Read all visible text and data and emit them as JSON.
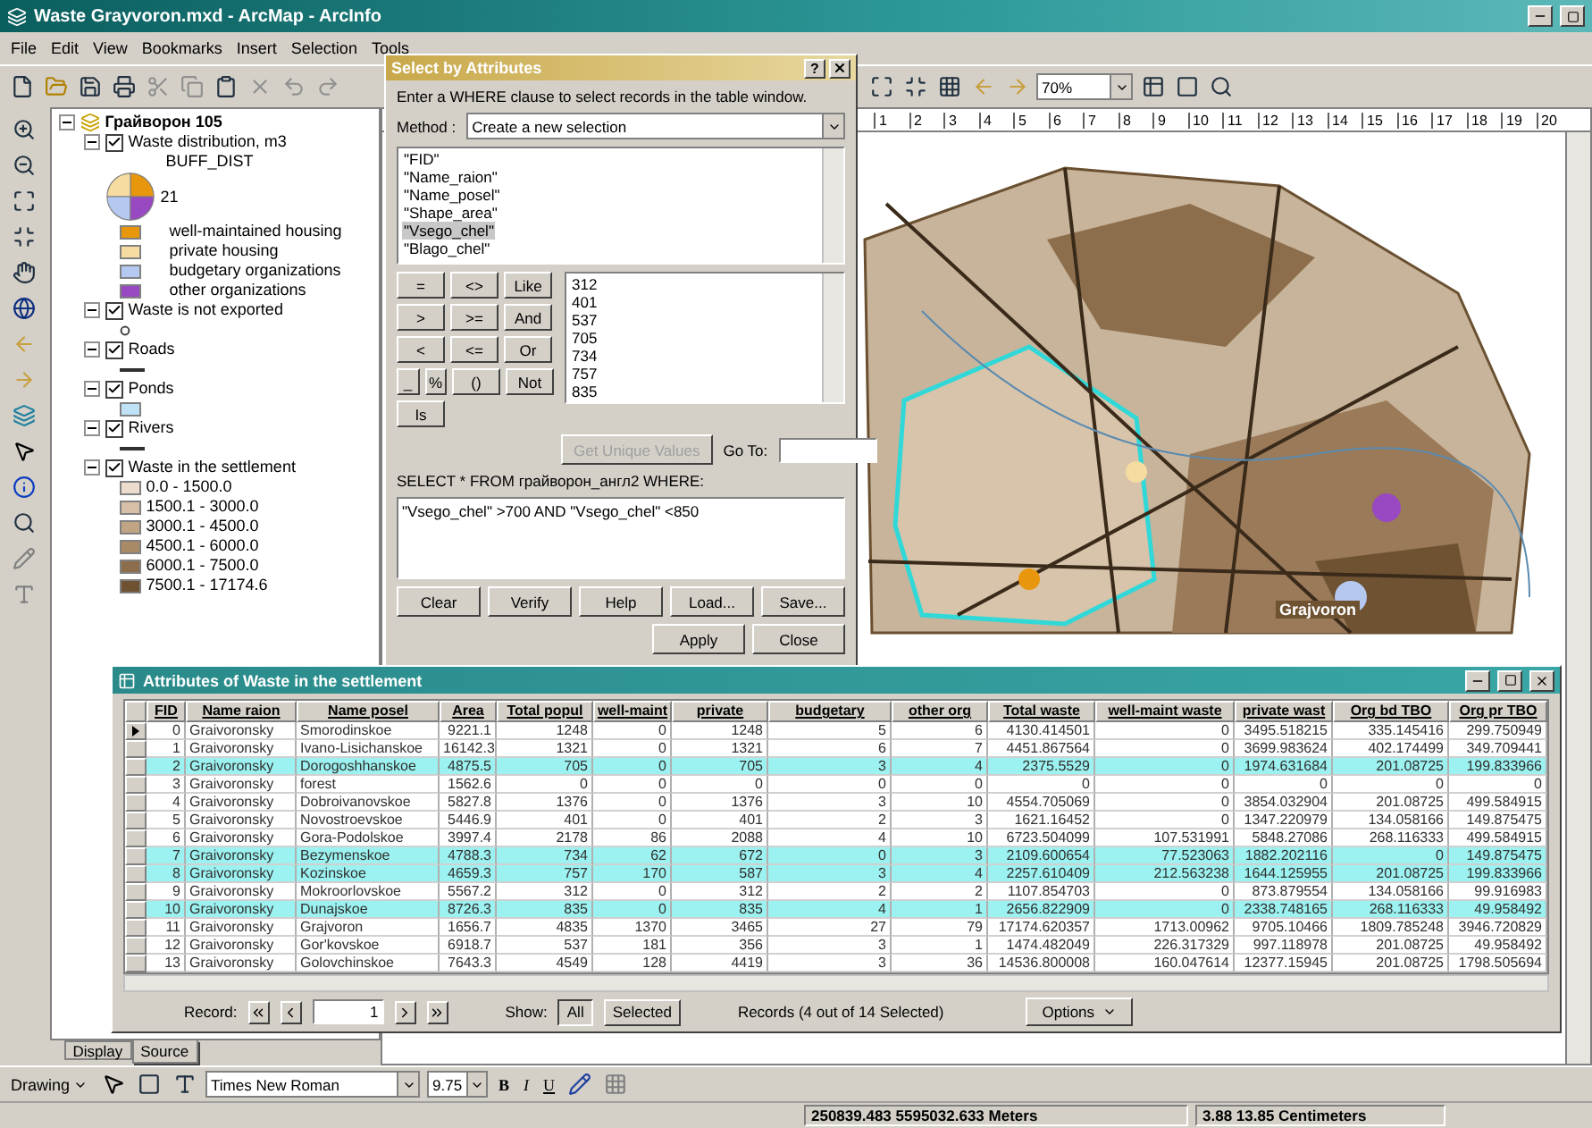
{
  "window": {
    "title": "Waste Grayvoron.mxd - ArcMap - ArcInfo"
  },
  "menu": [
    "File",
    "Edit",
    "View",
    "Bookmarks",
    "Insert",
    "Selection",
    "Tools"
  ],
  "map_scale": "70%",
  "ruler": [
    "1",
    "2",
    "3",
    "4",
    "5",
    "6",
    "7",
    "8",
    "9",
    "10",
    "11",
    "12",
    "13",
    "14",
    "15",
    "16",
    "17",
    "18",
    "19",
    "20"
  ],
  "toc": {
    "root": "Грайворон 105",
    "layers": [
      {
        "name": "Waste distribution, m3",
        "checked": true,
        "kind": "pie",
        "field": "BUFF_DIST",
        "size_label": "21",
        "classes": [
          {
            "label": "well-maintained housing",
            "color": "#e8960c"
          },
          {
            "label": "private housing",
            "color": "#f6dca0"
          },
          {
            "label": "budgetary organizations",
            "color": "#b4c8f0"
          },
          {
            "label": "other organizations",
            "color": "#9848c0"
          }
        ]
      },
      {
        "name": "Waste is not exported",
        "checked": true,
        "kind": "point"
      },
      {
        "name": "Roads",
        "checked": true,
        "kind": "line"
      },
      {
        "name": "Ponds",
        "checked": true,
        "kind": "fill",
        "color": "#bfe2f6"
      },
      {
        "name": "Rivers",
        "checked": true,
        "kind": "line"
      },
      {
        "name": "Waste in the settlement",
        "checked": true,
        "kind": "classes",
        "classes": [
          {
            "label": "0.0 - 1500.0",
            "color": "#ecdccc"
          },
          {
            "label": "1500.1 - 3000.0",
            "color": "#d6bfa6"
          },
          {
            "label": "3000.1 - 4500.0",
            "color": "#c0a584"
          },
          {
            "label": "4500.1 - 6000.0",
            "color": "#a88a66"
          },
          {
            "label": "6000.1 - 7500.0",
            "color": "#8c6e4c"
          },
          {
            "label": "7500.1 - 17174.6",
            "color": "#6e5232"
          }
        ]
      }
    ],
    "tabs": [
      {
        "label": "Display",
        "selected": false
      },
      {
        "label": "Source",
        "selected": true
      }
    ]
  },
  "map_labels": [
    "Grajvoron"
  ],
  "dialog": {
    "title": "Select by Attributes",
    "help": "?",
    "instruction": "Enter a WHERE clause to select records in the table window.",
    "method_label": "Method :",
    "method": "Create a new selection",
    "fields": [
      {
        "label": "\"FID\"",
        "selected": false
      },
      {
        "label": "\"Name_raion\"",
        "selected": false
      },
      {
        "label": "\"Name_posel\"",
        "selected": false
      },
      {
        "label": "\"Shape_area\"",
        "selected": false
      },
      {
        "label": "\"Vsego_chel\"",
        "selected": true
      },
      {
        "label": "\"Blago_chel\"",
        "selected": false
      }
    ],
    "operators": [
      [
        "=",
        "<>",
        "Like"
      ],
      [
        ">",
        ">=",
        "And"
      ],
      [
        "<",
        "<=",
        "Or"
      ],
      [
        "_",
        "%",
        "()",
        "Not"
      ],
      [
        "Is"
      ]
    ],
    "values": [
      "312",
      "401",
      "537",
      "705",
      "734",
      "757",
      "835"
    ],
    "unique_button": {
      "label": "Get Unique Values",
      "disabled": true
    },
    "goto_label": "Go To:",
    "query_label": "SELECT * FROM грайворон_англ2 WHERE:",
    "expression": "\"Vsego_chel\" >700 AND \"Vsego_chel\" <850",
    "buttons": [
      "Clear",
      "Verify",
      "Help",
      "Load...",
      "Save..."
    ],
    "footer_buttons": [
      "Apply",
      "Close"
    ]
  },
  "table": {
    "title": "Attributes of Waste in the settlement",
    "columns": [
      "FID",
      "Name raion",
      "Name posel",
      "Area",
      "Total popul",
      "well-maint",
      "private",
      "budgetary",
      "other org",
      "Total waste",
      "well-maint waste",
      "private wast",
      "Org bd TBO",
      "Org pr TBO"
    ],
    "rows": [
      {
        "selected": false,
        "cells": [
          "0",
          "Graivoronsky",
          "Smorodinskoe",
          "9221.1",
          "1248",
          "0",
          "1248",
          "5",
          "6",
          "4130.414501",
          "0",
          "3495.518215",
          "335.145416",
          "299.750949"
        ]
      },
      {
        "selected": false,
        "cells": [
          "1",
          "Graivoronsky",
          "Ivano-Lisichanskoe",
          "16142.3",
          "1321",
          "0",
          "1321",
          "6",
          "7",
          "4451.867564",
          "0",
          "3699.983624",
          "402.174499",
          "349.709441"
        ]
      },
      {
        "selected": true,
        "cells": [
          "2",
          "Graivoronsky",
          "Dorogoshhanskoe",
          "4875.5",
          "705",
          "0",
          "705",
          "3",
          "4",
          "2375.5529",
          "0",
          "1974.631684",
          "201.08725",
          "199.833966"
        ]
      },
      {
        "selected": false,
        "cells": [
          "3",
          "Graivoronsky",
          "forest",
          "1562.6",
          "0",
          "0",
          "0",
          "0",
          "0",
          "0",
          "0",
          "0",
          "0",
          "0"
        ]
      },
      {
        "selected": false,
        "cells": [
          "4",
          "Graivoronsky",
          "Dobroivanovskoe",
          "5827.8",
          "1376",
          "0",
          "1376",
          "3",
          "10",
          "4554.705069",
          "0",
          "3854.032904",
          "201.08725",
          "499.584915"
        ]
      },
      {
        "selected": false,
        "cells": [
          "5",
          "Graivoronsky",
          "Novostroevskoe",
          "5446.9",
          "401",
          "0",
          "401",
          "2",
          "3",
          "1621.16452",
          "0",
          "1347.220979",
          "134.058166",
          "149.875475"
        ]
      },
      {
        "selected": false,
        "cells": [
          "6",
          "Graivoronsky",
          "Gora-Podolskoe",
          "3997.4",
          "2178",
          "86",
          "2088",
          "4",
          "10",
          "6723.504099",
          "107.531991",
          "5848.27086",
          "268.116333",
          "499.584915"
        ]
      },
      {
        "selected": true,
        "cells": [
          "7",
          "Graivoronsky",
          "Bezymenskoe",
          "4788.3",
          "734",
          "62",
          "672",
          "0",
          "3",
          "2109.600654",
          "77.523063",
          "1882.202116",
          "0",
          "149.875475"
        ]
      },
      {
        "selected": true,
        "cells": [
          "8",
          "Graivoronsky",
          "Kozinskoe",
          "4659.3",
          "757",
          "170",
          "587",
          "3",
          "4",
          "2257.610409",
          "212.563238",
          "1644.125955",
          "201.08725",
          "199.833966"
        ]
      },
      {
        "selected": false,
        "cells": [
          "9",
          "Graivoronsky",
          "Mokroorlovskoe",
          "5567.2",
          "312",
          "0",
          "312",
          "2",
          "2",
          "1107.854703",
          "0",
          "873.879554",
          "134.058166",
          "99.916983"
        ]
      },
      {
        "selected": true,
        "cells": [
          "10",
          "Graivoronsky",
          "Dunajskoe",
          "8726.3",
          "835",
          "0",
          "835",
          "4",
          "1",
          "2656.822909",
          "0",
          "2338.748165",
          "268.116333",
          "49.958492"
        ]
      },
      {
        "selected": false,
        "cells": [
          "11",
          "Graivoronsky",
          "Grajvoron",
          "1656.7",
          "4835",
          "1370",
          "3465",
          "27",
          "79",
          "17174.620357",
          "1713.00962",
          "9705.10466",
          "1809.785248",
          "3946.720829"
        ]
      },
      {
        "selected": false,
        "cells": [
          "12",
          "Graivoronsky",
          "Gor'kovskoe",
          "6918.7",
          "537",
          "181",
          "356",
          "3",
          "1",
          "1474.482049",
          "226.317329",
          "997.118978",
          "201.08725",
          "49.958492"
        ]
      },
      {
        "selected": false,
        "cells": [
          "13",
          "Graivoronsky",
          "Golovchinskoe",
          "7643.3",
          "4549",
          "128",
          "4419",
          "3",
          "36",
          "14536.800008",
          "160.047614",
          "12377.15945",
          "201.08725",
          "1798.505694"
        ]
      }
    ],
    "record_label": "Record:",
    "record": "1",
    "show_label": "Show:",
    "show": [
      {
        "label": "All",
        "selected": true
      },
      {
        "label": "Selected",
        "selected": false
      }
    ],
    "status": "Records (4 out of 14 Selected)",
    "options": "Options"
  },
  "drawing_toolbar": {
    "menu": "Drawing",
    "font": "Times New Roman",
    "size": "9.75",
    "styles": [
      "B",
      "I",
      "U"
    ]
  },
  "status_bar": [
    "250839.483 5595032.633 Meters",
    "3.88 13.85 Centimeters"
  ]
}
